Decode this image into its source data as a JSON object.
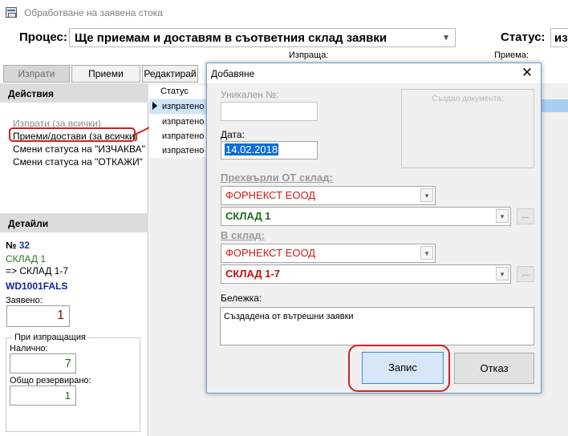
{
  "window": {
    "title": "Обработване на заявена стока"
  },
  "header": {
    "process_label": "Процес:",
    "process_value": "Ще приемам и доставям в съответния склад заявки",
    "status_label": "Статус:",
    "status_value": "из",
    "col_sends": "Изпраща:",
    "col_receives": "Приема:"
  },
  "tabs": [
    {
      "label": "Изпрати"
    },
    {
      "label": "Приеми"
    },
    {
      "label": "Редактирай"
    }
  ],
  "actions": {
    "title": "Действия",
    "items": [
      {
        "label": "Изпрати (за всички)"
      },
      {
        "label": "Приеми/достави (за всички)"
      },
      {
        "label": "Смени статуса на \"ИЗЧАКВА\""
      },
      {
        "label": "Смени статуса на \"ОТКАЖИ\""
      }
    ]
  },
  "details": {
    "title": "Детайли",
    "number_prefix": "№",
    "number": "32",
    "from_warehouse": "СКЛАД 1",
    "to_warehouse": "=> СКЛАД 1-7",
    "code": "WD1001FALS",
    "ordered_label": "Заявено:",
    "ordered_value": "1",
    "group_title": "При изпращащия",
    "available_label": "Налично:",
    "available_value": "7",
    "reserved_label": "Общо резервирано:",
    "reserved_value": "1"
  },
  "grid": {
    "header": "Статус",
    "rows": [
      {
        "status": "изпратено"
      },
      {
        "status": "изпратено"
      },
      {
        "status": "изпратено"
      },
      {
        "status": "изпратено"
      }
    ]
  },
  "dialog": {
    "title": "Добавяне",
    "close_glyph": "✕",
    "unique_no_label": "Уникален №:",
    "unique_no_value": "",
    "date_label": "Дата:",
    "date_value": "14.02.2018",
    "creator_label": "Създал документа:",
    "transfer_from_label": "Прехвърли ОТ склад:",
    "from_company": "ФОРНЕКСТ ЕООД",
    "from_warehouse": "СКЛАД 1",
    "to_label": "В склад:",
    "to_company": "ФОРНЕКСТ ЕООД",
    "to_warehouse": "СКЛАД 1-7",
    "dots_label": "...",
    "note_label": "Бележка:",
    "note_value": "Създадена от вътрешни заявки",
    "save_label": "Запис",
    "cancel_label": "Отказ"
  },
  "colors": {
    "annotation": "#d42020",
    "selection": "#0f6fd6",
    "warehouse_text": "#1f7a1f",
    "company_text": "#cc1b1b"
  }
}
